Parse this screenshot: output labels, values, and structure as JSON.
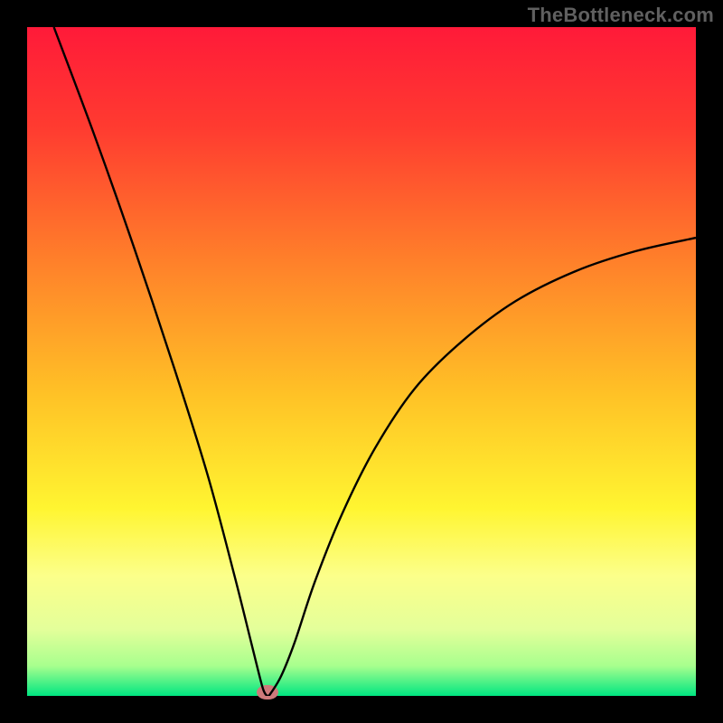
{
  "watermark": "TheBottleneck.com",
  "chart_data": {
    "type": "line",
    "title": "",
    "xlabel": "",
    "ylabel": "",
    "xlim": [
      0,
      1
    ],
    "ylim": [
      0,
      1
    ],
    "grid": false,
    "legend": false,
    "background_gradient": {
      "stops": [
        {
          "offset": 0.0,
          "color": "#FF1A39"
        },
        {
          "offset": 0.15,
          "color": "#FF3B30"
        },
        {
          "offset": 0.35,
          "color": "#FF802A"
        },
        {
          "offset": 0.55,
          "color": "#FFC226"
        },
        {
          "offset": 0.72,
          "color": "#FFF531"
        },
        {
          "offset": 0.82,
          "color": "#FCFF8A"
        },
        {
          "offset": 0.9,
          "color": "#E4FF9A"
        },
        {
          "offset": 0.955,
          "color": "#A8FF8E"
        },
        {
          "offset": 1.0,
          "color": "#00E681"
        }
      ]
    },
    "series": [
      {
        "name": "bottleneck-curve",
        "color": "#000000",
        "x": [
          0.04,
          0.1,
          0.16,
          0.22,
          0.27,
          0.31,
          0.335,
          0.35,
          0.355,
          0.36,
          0.365,
          0.38,
          0.4,
          0.43,
          0.47,
          0.52,
          0.58,
          0.65,
          0.73,
          0.82,
          0.91,
          1.0
        ],
        "y": [
          1.0,
          0.84,
          0.67,
          0.49,
          0.33,
          0.18,
          0.08,
          0.02,
          0.005,
          0.0,
          0.005,
          0.03,
          0.08,
          0.17,
          0.27,
          0.37,
          0.46,
          0.53,
          0.59,
          0.635,
          0.665,
          0.685
        ]
      }
    ],
    "marker": {
      "name": "sweet-spot-marker",
      "x": 0.36,
      "y": 0.005,
      "color": "#CE7A7B"
    }
  }
}
